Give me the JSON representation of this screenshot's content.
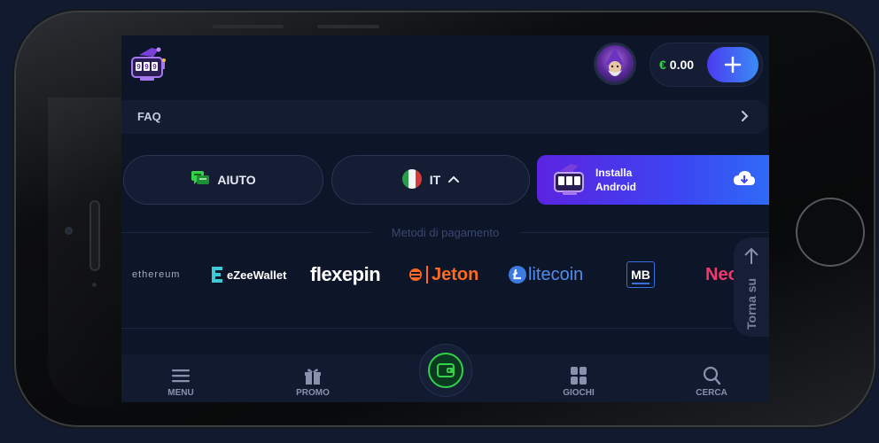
{
  "header": {
    "logo_icon": "wizard-slot-logo-icon",
    "avatar_icon": "wizard-avatar-icon",
    "balance": {
      "currency": "€",
      "amount": "0.00"
    },
    "add_funds_icon": "plus-icon"
  },
  "faq": {
    "label": "FAQ",
    "chevron_icon": "chevron-right-icon"
  },
  "actions": {
    "help": {
      "label": "AIUTO",
      "icon": "chat-help-icon",
      "icon_color": "#34d24a"
    },
    "language": {
      "label": "IT",
      "flag_icon": "italy-flag-icon",
      "chevron_icon": "chevron-up-icon"
    },
    "install": {
      "line1": "Installa",
      "line2": "Android",
      "icon": "cloud-download-icon"
    }
  },
  "payments": {
    "title": "Metodi di pagamento",
    "logos": [
      {
        "name": "ethereum",
        "text": "ethereum"
      },
      {
        "name": "ezeewallet",
        "text": "eZeeWallet"
      },
      {
        "name": "flexepin",
        "text": "flexepin"
      },
      {
        "name": "jeton",
        "text": "Jeton"
      },
      {
        "name": "litecoin",
        "text": "litecoin"
      },
      {
        "name": "multibanco",
        "text": "MB"
      },
      {
        "name": "neosurf",
        "text": "Neos"
      }
    ]
  },
  "back_to_top": {
    "label": "Torna su",
    "icon": "arrow-up-icon"
  },
  "bottom_nav": {
    "menu": "MENU",
    "promo": "PROMO",
    "wallet_icon": "wallet-icon",
    "games": "GIOCHI",
    "search": "CERCA"
  },
  "colors": {
    "background": "#0d1528",
    "accent_green": "#34d24a",
    "accent_purple": "#5b24e0",
    "accent_blue": "#2f6af6"
  }
}
